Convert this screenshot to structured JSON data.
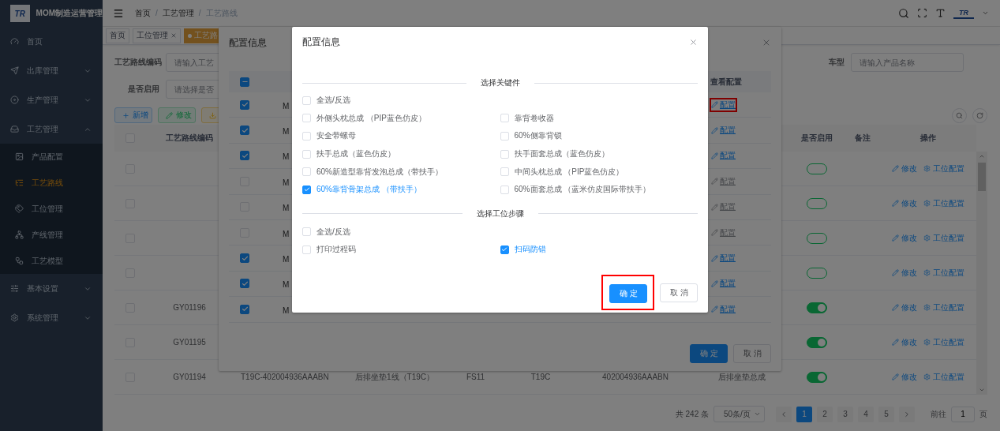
{
  "sidebar": {
    "logo": "TR",
    "title": "MOM制造运营管理",
    "items": [
      {
        "label": "首页"
      },
      {
        "label": "出库管理",
        "expanded": false
      },
      {
        "label": "生产管理",
        "expanded": false
      },
      {
        "label": "工艺管理",
        "expanded": true,
        "children": [
          {
            "label": "产品配置",
            "selected": false
          },
          {
            "label": "工艺路线",
            "selected": true
          },
          {
            "label": "工位管理",
            "selected": false
          },
          {
            "label": "产线管理",
            "selected": false
          },
          {
            "label": "工艺模型",
            "selected": false
          }
        ]
      },
      {
        "label": "基本设置",
        "expanded": false
      },
      {
        "label": "系统管理",
        "expanded": false
      }
    ]
  },
  "header": {
    "breadcrumb": [
      "首页",
      "工艺管理",
      "工艺路线"
    ],
    "separator": "/",
    "avatar_logo": "TR"
  },
  "tags": [
    {
      "label": "首页",
      "selected": false,
      "closable": false
    },
    {
      "label": "工位管理",
      "selected": false,
      "closable": true
    },
    {
      "label": "工艺路",
      "selected": true,
      "closable": false
    }
  ],
  "search_form": [
    [
      {
        "label": "工艺路线编码",
        "placeholder": "请输入工艺"
      },
      {
        "label": "车型",
        "placeholder": "请输入产品名称"
      }
    ],
    [
      {
        "label": "是否启用",
        "placeholder": "请选择是否"
      }
    ]
  ],
  "toolbar": [
    {
      "label": "新增",
      "kind": "primary"
    },
    {
      "label": "修改",
      "kind": "success"
    },
    {
      "kind": "warning"
    }
  ],
  "table": {
    "header_checkbox": {
      "checked": false
    },
    "columns": {
      "code": "工艺路线编码",
      "enabled": "是否启用",
      "remark": "备注",
      "actions": "操作"
    },
    "rows": [
      {
        "checked": false,
        "enabled": false,
        "actions": [
          "修改",
          "工位配置"
        ]
      },
      {
        "checked": false,
        "enabled": false,
        "actions": [
          "修改",
          "工位配置"
        ]
      },
      {
        "checked": false,
        "enabled": false,
        "actions": [
          "修改",
          "工位配置"
        ]
      },
      {
        "checked": false,
        "enabled": false,
        "actions": [
          "修改",
          "工位配置"
        ]
      },
      {
        "checked": false,
        "code": "GY01196",
        "enabled": true,
        "actions": [
          "修改",
          "工位配置"
        ]
      },
      {
        "checked": false,
        "code": "GY01195",
        "enabled": true,
        "actions": [
          "修改",
          "工位配置"
        ]
      },
      {
        "checked": false,
        "code": "GY01194",
        "column_3": "T19C-402004936AAABN",
        "column_4": "后排坐垫1线（T19C）",
        "column_5": "FS11",
        "column_6": "T19C",
        "column_7": "402004936AAABN",
        "column_8": "后排坐垫总成",
        "enabled": true,
        "actions": [
          "修改",
          "工位配置"
        ]
      }
    ]
  },
  "pagination": {
    "total": "共 242 条",
    "page_size": "50条/页",
    "pages": [
      {
        "label": "1",
        "selected": true
      },
      {
        "label": "2",
        "selected": false
      },
      {
        "label": "3",
        "selected": false
      },
      {
        "label": "4",
        "selected": false
      },
      {
        "label": "5",
        "selected": false
      }
    ],
    "goto_label": "前往",
    "goto_value": "1",
    "goto_suffix": "页"
  },
  "dialog_outer": {
    "title": "配置信息",
    "header_checkbox": {
      "indeterminate": true
    },
    "config_column": "查看配置",
    "rows": [
      {
        "checked": true,
        "column_2": "M",
        "config": {
          "label": "配置",
          "disabled": false,
          "highlighted": true
        }
      },
      {
        "checked": true,
        "column_2": "M",
        "config": {
          "label": "配置",
          "disabled": false,
          "highlighted": false
        }
      },
      {
        "checked": true,
        "column_2": "M",
        "config": {
          "label": "配置",
          "disabled": false,
          "highlighted": false
        }
      },
      {
        "checked": false,
        "column_2": "M",
        "config": {
          "label": "配置",
          "disabled": true,
          "highlighted": false
        }
      },
      {
        "checked": false,
        "column_2": "M",
        "config": {
          "label": "配置",
          "disabled": true,
          "highlighted": false
        }
      },
      {
        "checked": false,
        "column_2": "M",
        "config": {
          "label": "配置",
          "disabled": true,
          "highlighted": false
        }
      },
      {
        "checked": true,
        "column_2": "M",
        "config": {
          "label": "配置",
          "disabled": false,
          "highlighted": false
        }
      },
      {
        "checked": true,
        "column_2": "M",
        "config": {
          "label": "配置",
          "disabled": false,
          "highlighted": false
        }
      },
      {
        "checked": true,
        "column_2": "M",
        "config": {
          "label": "配置",
          "disabled": false,
          "highlighted": false
        }
      }
    ],
    "buttons": [
      {
        "label": "确定",
        "kind": "primary",
        "highlighted": false
      },
      {
        "label": "取消",
        "kind": "default",
        "highlighted": false
      }
    ]
  },
  "dialog_inner": {
    "title": "配置信息",
    "sections": [
      {
        "title": "选择关键件",
        "select_all": {
          "label": "全选/反选",
          "checked": false
        },
        "items": [
          {
            "label": "外侧头枕总成 （PIP蓝色仿皮）",
            "checked": false
          },
          {
            "label": "靠背卷收器",
            "checked": false
          },
          {
            "label": "安全带螺母",
            "checked": false
          },
          {
            "label": "60%侧靠背锁",
            "checked": false
          },
          {
            "label": "扶手总成（蓝色仿皮）",
            "checked": false
          },
          {
            "label": "扶手面套总成（蓝色仿皮）",
            "checked": false
          },
          {
            "label": "60%新造型靠背发泡总成（带扶手）",
            "checked": false
          },
          {
            "label": "中间头枕总成 （PIP蓝色仿皮）",
            "checked": false
          },
          {
            "label": "60%靠背骨架总成 （带扶手）",
            "checked": true
          },
          {
            "label": "60%面套总成 （蓝米仿皮国际带扶手）",
            "checked": false
          }
        ]
      },
      {
        "title": "选择工位步骤",
        "select_all": {
          "label": "全选/反选",
          "checked": false
        },
        "items": [
          {
            "label": "打印过程码",
            "checked": false
          },
          {
            "label": "扫码防错",
            "checked": true
          }
        ]
      }
    ],
    "buttons": [
      {
        "label": "确定",
        "kind": "primary",
        "highlighted": true
      },
      {
        "label": "取消",
        "kind": "default",
        "highlighted": false
      }
    ]
  }
}
